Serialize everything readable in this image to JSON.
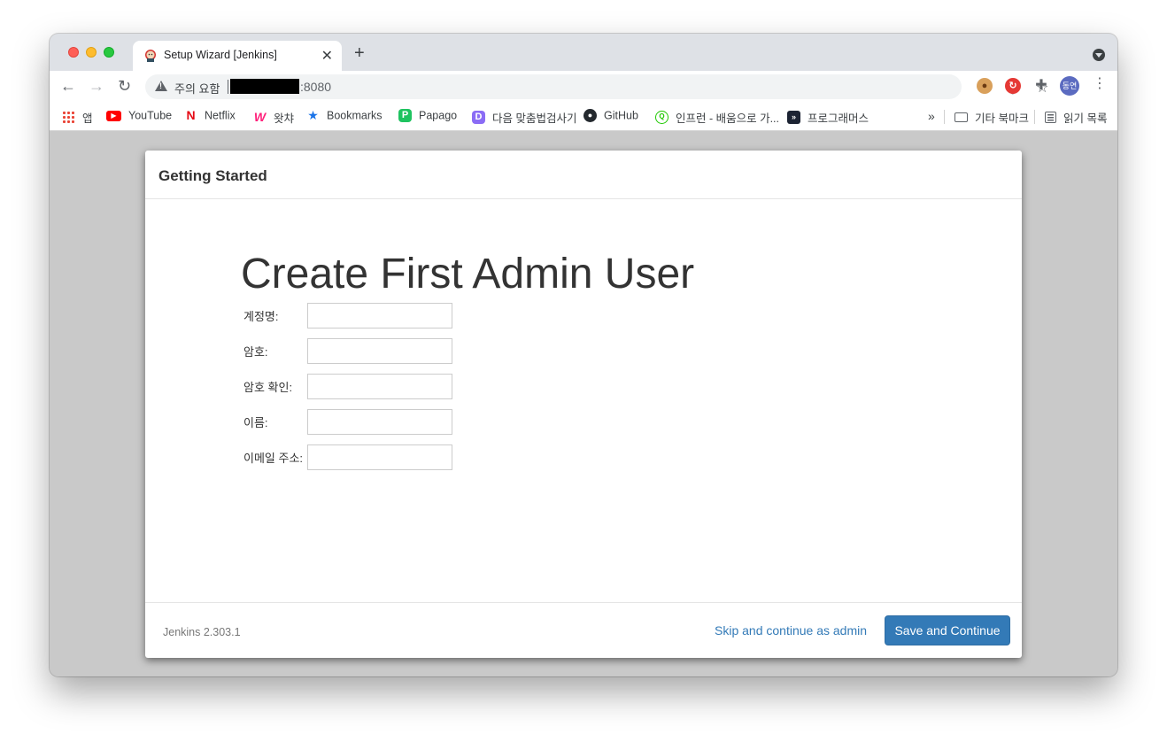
{
  "browser": {
    "tab_title": "Setup Wizard [Jenkins]",
    "tab_close": "✕",
    "new_tab": "+",
    "address": {
      "security_label": "주의 요함",
      "url_suffix": ":8080"
    },
    "profile_initials": "동연"
  },
  "bookmarks": [
    {
      "label": "앱",
      "icon": "apps-grid-icon"
    },
    {
      "label": "YouTube",
      "icon": "youtube-icon"
    },
    {
      "label": "Netflix",
      "icon": "netflix-icon"
    },
    {
      "label": "왓챠",
      "icon": "watcha-icon"
    },
    {
      "label": "Bookmarks",
      "icon": "star-icon"
    },
    {
      "label": "Papago",
      "icon": "papago-icon"
    },
    {
      "label": "다음 맞춤법검사기",
      "icon": "daum-icon"
    },
    {
      "label": "GitHub",
      "icon": "github-icon"
    },
    {
      "label": "인프런 - 배움으로 가...",
      "icon": "inflearn-icon"
    },
    {
      "label": "프로그래머스",
      "icon": "programmers-icon"
    }
  ],
  "bookmarks_overflow": "»",
  "other_bookmarks": "기타 북마크",
  "reading_list": "읽기 목록",
  "dialog": {
    "title": "Getting Started",
    "heading": "Create First Admin User",
    "fields": [
      {
        "label": "계정명:",
        "value": ""
      },
      {
        "label": "암호:",
        "value": ""
      },
      {
        "label": "암호 확인:",
        "value": ""
      },
      {
        "label": "이름:",
        "value": ""
      },
      {
        "label": "이메일 주소:",
        "value": ""
      }
    ],
    "version": "Jenkins 2.303.1",
    "skip_label": "Skip and continue as admin",
    "save_label": "Save and Continue"
  },
  "colors": {
    "primary_button": "#337ab7",
    "link": "#337ab7"
  }
}
